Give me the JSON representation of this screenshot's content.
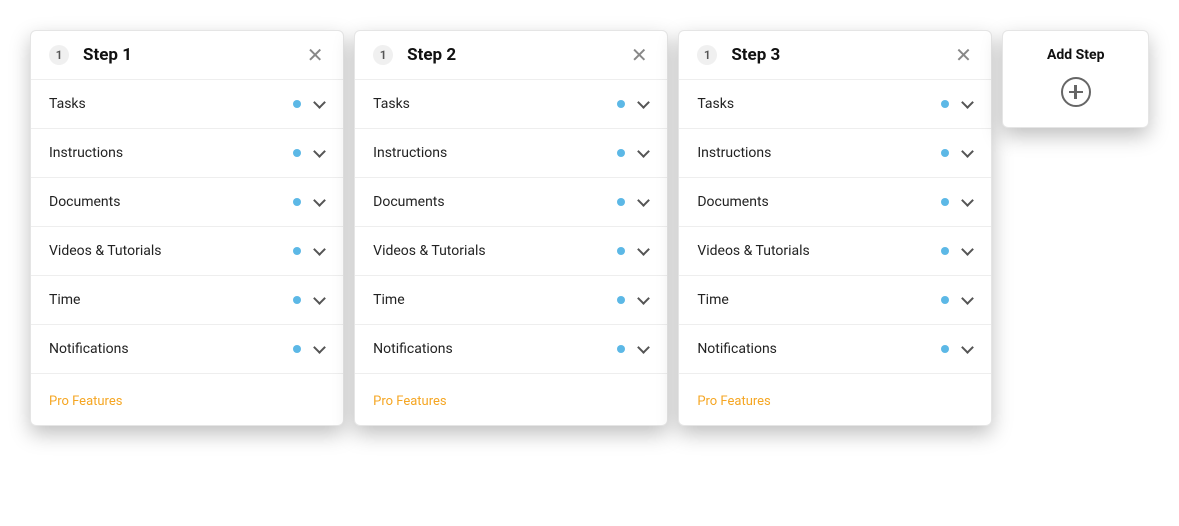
{
  "steps": [
    {
      "number": "1",
      "title": "Step 1",
      "rows": [
        {
          "label": "Tasks"
        },
        {
          "label": "Instructions"
        },
        {
          "label": "Documents"
        },
        {
          "label": "Videos & Tutorials"
        },
        {
          "label": "Time"
        },
        {
          "label": "Notifications"
        }
      ],
      "pro_label": "Pro Features"
    },
    {
      "number": "1",
      "title": "Step 2",
      "rows": [
        {
          "label": "Tasks"
        },
        {
          "label": "Instructions"
        },
        {
          "label": "Documents"
        },
        {
          "label": "Videos & Tutorials"
        },
        {
          "label": "Time"
        },
        {
          "label": "Notifications"
        }
      ],
      "pro_label": "Pro Features"
    },
    {
      "number": "1",
      "title": "Step 3",
      "rows": [
        {
          "label": "Tasks"
        },
        {
          "label": "Instructions"
        },
        {
          "label": "Documents"
        },
        {
          "label": "Videos & Tutorials"
        },
        {
          "label": "Time"
        },
        {
          "label": "Notifications"
        }
      ],
      "pro_label": "Pro Features"
    }
  ],
  "add_step": {
    "label": "Add Step"
  },
  "colors": {
    "dot": "#5cb8e6",
    "pro": "#f5a623"
  }
}
